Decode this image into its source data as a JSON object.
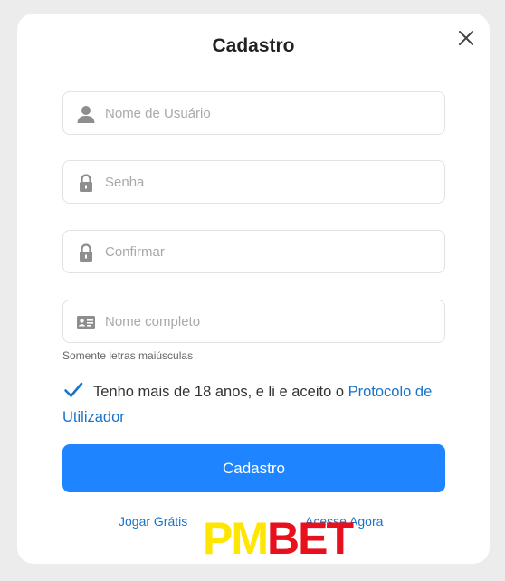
{
  "modal": {
    "title": "Cadastro",
    "close_icon": "close-icon"
  },
  "form": {
    "username": {
      "placeholder": "Nome de Usuário",
      "value": "",
      "icon": "user-icon"
    },
    "password": {
      "placeholder": "Senha",
      "value": "",
      "icon": "lock-icon"
    },
    "confirm": {
      "placeholder": "Confirmar",
      "value": "",
      "icon": "lock-icon"
    },
    "fullname": {
      "placeholder": "Nome completo",
      "value": "",
      "icon": "id-card-icon"
    },
    "fullname_hint": "Somente letras maiúsculas",
    "agreement": {
      "checked": true,
      "text": "Tenho mais de 18 anos, e li e aceito o ",
      "link": "Protocolo de Utilizador"
    },
    "submit_label": "Cadastro"
  },
  "footer": {
    "left_link": "Jogar Grátis",
    "right_link": "Acesse Agora"
  },
  "watermark": {
    "part1": "PM",
    "part2": "BET",
    "colors": {
      "part1": "#ffe600",
      "part2": "#e8101d"
    }
  },
  "colors": {
    "accent": "#1e84ff",
    "link": "#1a73c8",
    "checkbox": "#1a73c8"
  }
}
